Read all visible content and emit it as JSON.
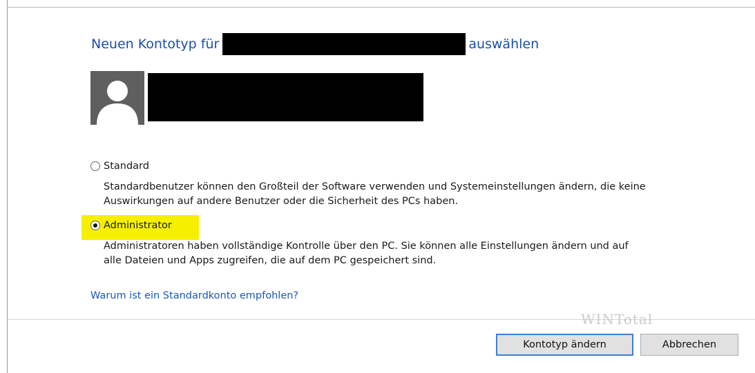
{
  "dialog": {
    "title_prefix": "Neuen Kontotyp für",
    "title_suffix": "auswählen",
    "options": [
      {
        "label": "Standard",
        "selected": false,
        "description_line1": "Standardbenutzer können den Großteil der Software verwenden und Systemeinstellungen ändern, die keine",
        "description_line2": "Auswirkungen auf andere Benutzer oder die Sicherheit des PCs haben."
      },
      {
        "label": "Administrator",
        "selected": true,
        "highlighted": true,
        "description_line1": "Administratoren haben vollständige Kontrolle über den PC. Sie können alle Einstellungen ändern und auf",
        "description_line2": "alle Dateien und Apps zugreifen, die auf dem PC gespeichert sind."
      }
    ],
    "help_link": "Warum ist ein Standardkonto empfohlen?",
    "buttons": {
      "confirm": "Kontotyp ändern",
      "cancel": "Abbrechen"
    }
  },
  "watermark": "WINTotal",
  "colors": {
    "title": "#1c4fa3",
    "link": "#1c56b4",
    "highlight": "#f6f000",
    "primary_button_border": "#3c7fd0"
  }
}
